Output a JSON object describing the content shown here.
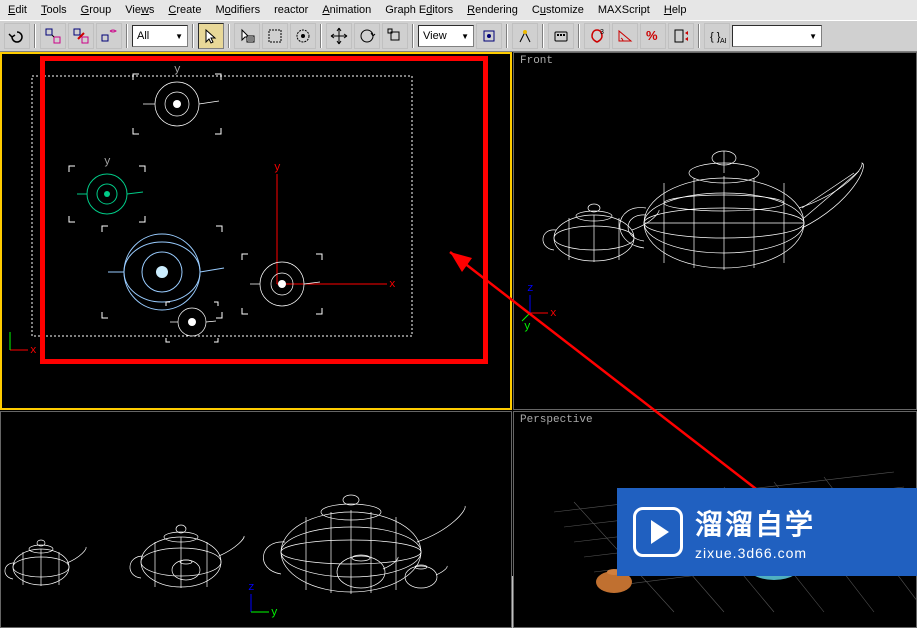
{
  "menu": {
    "edit": "Edit",
    "tools": "Tools",
    "group": "Group",
    "views": "Views",
    "create": "Create",
    "modifiers": "Modifiers",
    "reactor": "reactor",
    "animation": "Animation",
    "grapheditors": "Graph Editors",
    "rendering": "Rendering",
    "customize": "Customize",
    "maxscript": "MAXScript",
    "help": "Help"
  },
  "toolbar": {
    "selection_filter": "All",
    "ref_coord": "View"
  },
  "viewports": {
    "front": "Front",
    "perspective": "Perspective"
  },
  "axes": {
    "x": "x",
    "y": "y",
    "z": "z"
  },
  "watermark": {
    "main": "溜溜自学",
    "sub": "zixue.3d66.com"
  }
}
